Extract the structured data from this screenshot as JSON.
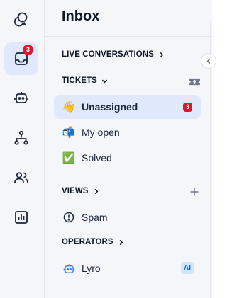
{
  "rail": {
    "inbox_badge": "3",
    "icons": [
      "chat-bubbles-icon",
      "inbox-icon",
      "bot-icon",
      "flow-icon",
      "contacts-icon",
      "analytics-icon"
    ]
  },
  "panel": {
    "title": "Inbox",
    "live_conversations": "LIVE CONVERSATIONS",
    "tickets": "TICKETS",
    "views": "VIEWS",
    "operators": "OPERATORS"
  },
  "tickets": [
    {
      "emoji": "👋",
      "label": "Unassigned",
      "badge": "3"
    },
    {
      "emoji": "📬",
      "label": "My open"
    },
    {
      "emoji": "✅",
      "label": "Solved"
    }
  ],
  "views": [
    {
      "label": "Spam"
    }
  ],
  "operators": [
    {
      "label": "Lyro",
      "tag": "AI"
    }
  ],
  "colors": {
    "accent_bg": "#dfe9fb",
    "badge": "#e0142b",
    "ai_tag_bg": "#cfe6ff",
    "ai_tag_text": "#1b5fd6"
  }
}
